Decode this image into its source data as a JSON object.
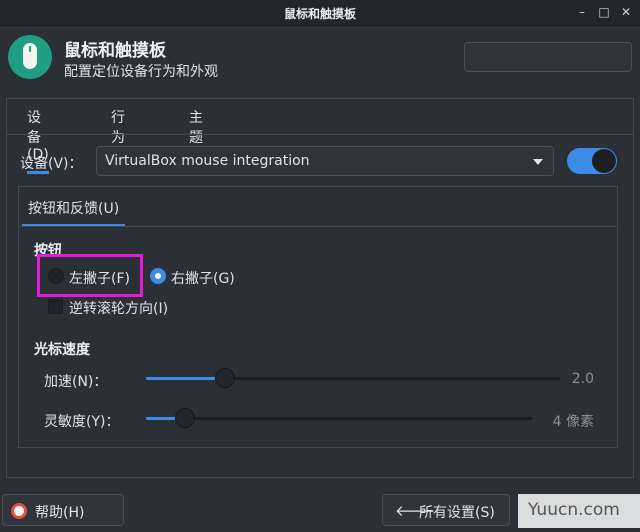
{
  "window": {
    "title": "鼠标和触摸板"
  },
  "header": {
    "title": "鼠标和触摸板",
    "subtitle": "配置定位设备行为和外观",
    "search_placeholder": ""
  },
  "tabs": [
    {
      "label": "设备(D)",
      "active": true
    },
    {
      "label": "行为(B)",
      "active": false
    },
    {
      "label": "主题(T)",
      "active": false
    }
  ],
  "device": {
    "label": "设备(V)：",
    "selected": "VirtualBox mouse integration",
    "enabled": true
  },
  "inner_tab": {
    "label": "按钮和反馈(U)"
  },
  "buttons_section": {
    "title": "按钮",
    "left_handed": {
      "label": "左撇子(F)",
      "selected": false
    },
    "right_handed": {
      "label": "右撇子(G)",
      "selected": true
    },
    "reverse_scroll": {
      "label": "逆转滚轮方向(I)",
      "checked": false
    }
  },
  "pointer_speed": {
    "title": "光标速度",
    "acceleration": {
      "label": "加速(N)：",
      "value": 2.0,
      "value_text": "2.0",
      "fraction": 0.19
    },
    "sensitivity": {
      "label": "灵敏度(Y)：",
      "value_text": "4 像素",
      "fraction": 0.1
    }
  },
  "footer": {
    "help_label": "帮助(H)",
    "all_settings_label": "所有设置(S)"
  },
  "watermark": "Yuucn.com",
  "colors": {
    "accent": "#3c8ce7",
    "highlight": "#e21bd9",
    "app_icon": "#1f9e83"
  }
}
